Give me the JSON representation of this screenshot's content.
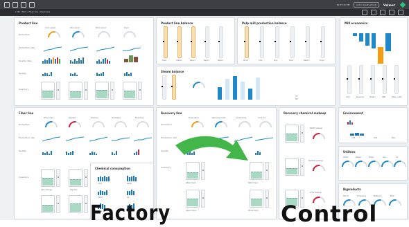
{
  "topbar": {
    "time": "10:55:15 PM",
    "user": "(john.doe@valmet)",
    "brand": "Valmet"
  },
  "navbar": {
    "breadcrumb": "/ Mill / Mill > Fiber line / Overview"
  },
  "panels": {
    "product_line": {
      "title": "Product line",
      "rows": [
        "Production",
        "Production rate",
        "Quality data",
        "Quality",
        "Inventory"
      ],
      "gauges": [
        "Oven speed",
        "Wire speed",
        "Press speed",
        "Dryer"
      ]
    },
    "product_line_balance": {
      "title": "Product line balance",
      "labels": [
        "Feed",
        "Outlet",
        "Reject",
        "Reject",
        "Reject"
      ]
    },
    "pulp_mill_production_balance": {
      "title": "Pulp mill production balance",
      "labels": [
        "Wood",
        "Chip",
        "Pulp",
        "Fiber",
        "Bleach",
        "Dryer"
      ]
    },
    "mill_economics": {
      "title": "Mill economics",
      "labels": [
        "Cost",
        "Revenue",
        "Margin",
        "OEE",
        "Other costs"
      ]
    },
    "steam_balance": {
      "title": "Steam balance",
      "legend": [
        "HP",
        "MP",
        "LP"
      ],
      "labels": [
        "Recovery",
        "Power",
        "Dryer",
        "Turbine",
        "Bleach",
        "Evap"
      ]
    },
    "fiber_line": {
      "title": "Fiber line",
      "rows": [
        "Production",
        "Production rate",
        "Quality",
        "Inventory"
      ],
      "gauges": [
        "Wood chips",
        "Digester",
        "Washing",
        "O2 Deligni.",
        "Bleaching"
      ],
      "tank_labels": [
        "Chip storage",
        "Digester",
        "Brown stock",
        "Oxygen stage",
        "Bleach tower"
      ]
    },
    "recovery_line": {
      "title": "Recovery line",
      "rows": [
        "Production",
        "Production rate",
        "Quality",
        "Inventory"
      ],
      "gauges": [
        "Evaporation",
        "Recovery boiler",
        "Causticizing",
        "Lime kiln"
      ],
      "tank_labels": [
        "Weak liquor",
        "Black liquor",
        "Green liquor",
        "White liquor"
      ]
    },
    "recovery_chemical_makeup": {
      "title": "Recovery chemical makeup",
      "labels": [
        "NaOH makeup",
        "Na2SO4 makeup",
        "Lime makeup"
      ]
    },
    "environment": {
      "title": "Environment",
      "labels": [
        "CO2",
        "SO2",
        "NOx"
      ]
    },
    "chemical_consumption": {
      "title": "Chemical consumption",
      "labels": [
        "ClO2",
        "NaOH",
        "H2O2",
        "O2",
        "Lime",
        "Na2SO4"
      ]
    },
    "utilities": {
      "title": "Utilities",
      "gauges": [
        "Water",
        "Steam",
        "Power",
        "Gas",
        "Air"
      ]
    },
    "byproducts": {
      "title": "Byproducts",
      "gauges": [
        "Tall oil",
        "Turpentine",
        "Methanol",
        "Bark"
      ]
    }
  },
  "caption": {
    "left": "Factory",
    "right": "Control"
  },
  "colors": {
    "topbar": "#3c3f44",
    "canvas": "#eef1f4",
    "accent_blue": "#1e88c8",
    "accent_red": "#d11f3f",
    "accent_orange": "#f39c12",
    "accent_green": "#2ec27e"
  }
}
